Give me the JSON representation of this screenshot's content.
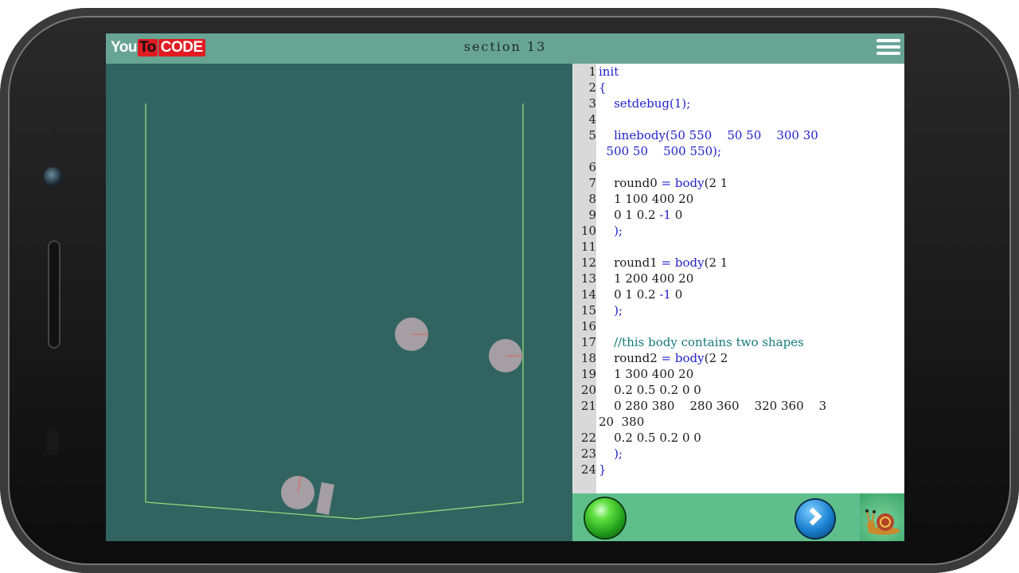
{
  "header": {
    "logo": {
      "you": "You",
      "to": "To",
      "code": "CODE"
    },
    "title": "section 13"
  },
  "colors": {
    "topbar": "#68a494",
    "sim_background": "#316460",
    "walls": "#9be07d",
    "bodies": "#a59ea2",
    "keyword": "#2222cc",
    "comment": "#147a7a",
    "bottombar": "#5fbf8c"
  },
  "code": {
    "lines": [
      {
        "n": "1",
        "segs": [
          {
            "t": "init",
            "c": "kw"
          }
        ]
      },
      {
        "n": "2",
        "segs": [
          {
            "t": "{",
            "c": "kw"
          }
        ]
      },
      {
        "n": "3",
        "segs": [
          {
            "t": "    "
          },
          {
            "t": "setdebug",
            "c": "kw"
          },
          {
            "t": "(1);",
            "c": "kw"
          }
        ]
      },
      {
        "n": "4",
        "segs": []
      },
      {
        "n": "5",
        "segs": [
          {
            "t": "    "
          },
          {
            "t": "linebody",
            "c": "kw"
          },
          {
            "t": "(50 550    50 50    300 30",
            "c": "kw"
          }
        ]
      },
      {
        "n": "",
        "segs": [
          {
            "t": "  500 50    500 550);",
            "c": "kw"
          }
        ]
      },
      {
        "n": "6",
        "segs": []
      },
      {
        "n": "7",
        "segs": [
          {
            "t": "    round0 "
          },
          {
            "t": "=",
            "c": "op"
          },
          {
            "t": " "
          },
          {
            "t": "body",
            "c": "kw"
          },
          {
            "t": "(2 1"
          }
        ]
      },
      {
        "n": "8",
        "segs": [
          {
            "t": "    1 100 400 20"
          }
        ]
      },
      {
        "n": "9",
        "segs": [
          {
            "t": "    0 1 0.2 "
          },
          {
            "t": "-1",
            "c": "op"
          },
          {
            "t": " 0"
          }
        ]
      },
      {
        "n": "10",
        "segs": [
          {
            "t": "    );",
            "c": "kw"
          }
        ]
      },
      {
        "n": "11",
        "segs": []
      },
      {
        "n": "12",
        "segs": [
          {
            "t": "    round1 "
          },
          {
            "t": "=",
            "c": "op"
          },
          {
            "t": " "
          },
          {
            "t": "body",
            "c": "kw"
          },
          {
            "t": "(2 1"
          }
        ]
      },
      {
        "n": "13",
        "segs": [
          {
            "t": "    1 200 400 20"
          }
        ]
      },
      {
        "n": "14",
        "segs": [
          {
            "t": "    0 1 0.2 "
          },
          {
            "t": "-1",
            "c": "op"
          },
          {
            "t": " 0"
          }
        ]
      },
      {
        "n": "15",
        "segs": [
          {
            "t": "    );",
            "c": "kw"
          }
        ]
      },
      {
        "n": "16",
        "segs": []
      },
      {
        "n": "17",
        "segs": [
          {
            "t": "    //this body contains two shapes",
            "c": "cm"
          }
        ]
      },
      {
        "n": "18",
        "segs": [
          {
            "t": "    round2 "
          },
          {
            "t": "=",
            "c": "op"
          },
          {
            "t": " "
          },
          {
            "t": "body",
            "c": "kw"
          },
          {
            "t": "(2 2"
          }
        ]
      },
      {
        "n": "19",
        "segs": [
          {
            "t": "    1 300 400 20"
          }
        ]
      },
      {
        "n": "20",
        "segs": [
          {
            "t": "    0.2 0.5 0.2 0 0"
          }
        ]
      },
      {
        "n": "21",
        "segs": [
          {
            "t": "    0 280 380    280 360    320 360    3"
          }
        ]
      },
      {
        "n": "",
        "segs": [
          {
            "t": "20  380"
          }
        ]
      },
      {
        "n": "22",
        "segs": [
          {
            "t": "    0.2 0.5 0.2 0 0"
          }
        ]
      },
      {
        "n": "23",
        "segs": [
          {
            "t": "    );",
            "c": "kw"
          }
        ]
      },
      {
        "n": "24",
        "segs": [
          {
            "t": "}",
            "c": "kw"
          }
        ]
      }
    ]
  },
  "icons": {
    "menu": "hamburger-menu-icon",
    "run": "green-run-icon",
    "next": "next-arrow-icon",
    "mascot": "snail-mascot-icon"
  }
}
